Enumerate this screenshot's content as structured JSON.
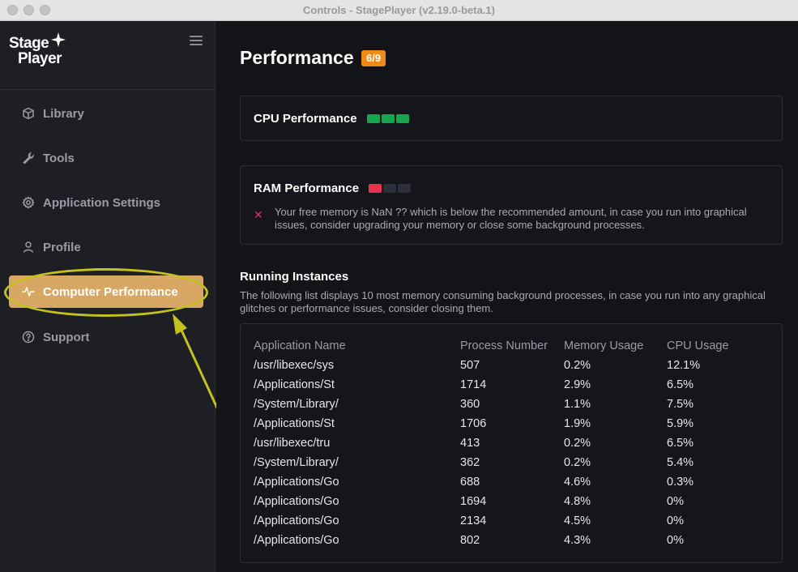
{
  "window": {
    "title": "Controls - StagePlayer (v2.19.0-beta.1)"
  },
  "logo": {
    "line1": "Stage",
    "line2": "Player"
  },
  "sidebar": {
    "items": [
      {
        "label": "Library",
        "icon": "cube-icon",
        "active": false
      },
      {
        "label": "Tools",
        "icon": "wrench-icon",
        "active": false
      },
      {
        "label": "Application Settings",
        "icon": "gear-icon",
        "active": false
      },
      {
        "label": "Profile",
        "icon": "user-icon",
        "active": false
      },
      {
        "label": "Computer Performance",
        "icon": "activity-icon",
        "active": true
      },
      {
        "label": "Support",
        "icon": "help-circle-icon",
        "active": false
      }
    ]
  },
  "main": {
    "title": "Performance",
    "badge": "6/9",
    "cpu": {
      "label": "CPU Performance",
      "score": 3,
      "max": 3,
      "color": "#15a54a"
    },
    "ram": {
      "label": "RAM Performance",
      "score": 1,
      "max": 3,
      "color": "#e8334c",
      "warning": "Your free memory is NaN ?? which is below the recommended amount, in case you run into graphical issues, consider upgrading your memory or close some background processes."
    },
    "instances": {
      "title": "Running Instances",
      "description": "The following list displays 10 most memory consuming background processes, in case you run into any graphical glitches or performance issues, consider closing them.",
      "columns": [
        "Application Name",
        "Process Number",
        "Memory Usage",
        "CPU Usage"
      ],
      "rows": [
        [
          "/usr/libexec/sys",
          "507",
          "0.2%",
          "12.1%"
        ],
        [
          "/Applications/St",
          "1714",
          "2.9%",
          "6.5%"
        ],
        [
          "/System/Library/",
          "360",
          "1.1%",
          "7.5%"
        ],
        [
          "/Applications/St",
          "1706",
          "1.9%",
          "5.9%"
        ],
        [
          "/usr/libexec/tru",
          "413",
          "0.2%",
          "6.5%"
        ],
        [
          "/System/Library/",
          "362",
          "0.2%",
          "5.4%"
        ],
        [
          "/Applications/Go",
          "688",
          "4.6%",
          "0.3%"
        ],
        [
          "/Applications/Go",
          "1694",
          "4.8%",
          "0%"
        ],
        [
          "/Applications/Go",
          "2134",
          "4.5%",
          "0%"
        ],
        [
          "/Applications/Go",
          "802",
          "4.3%",
          "0%"
        ]
      ]
    }
  },
  "annotation": {
    "color": "#c4c21c"
  }
}
